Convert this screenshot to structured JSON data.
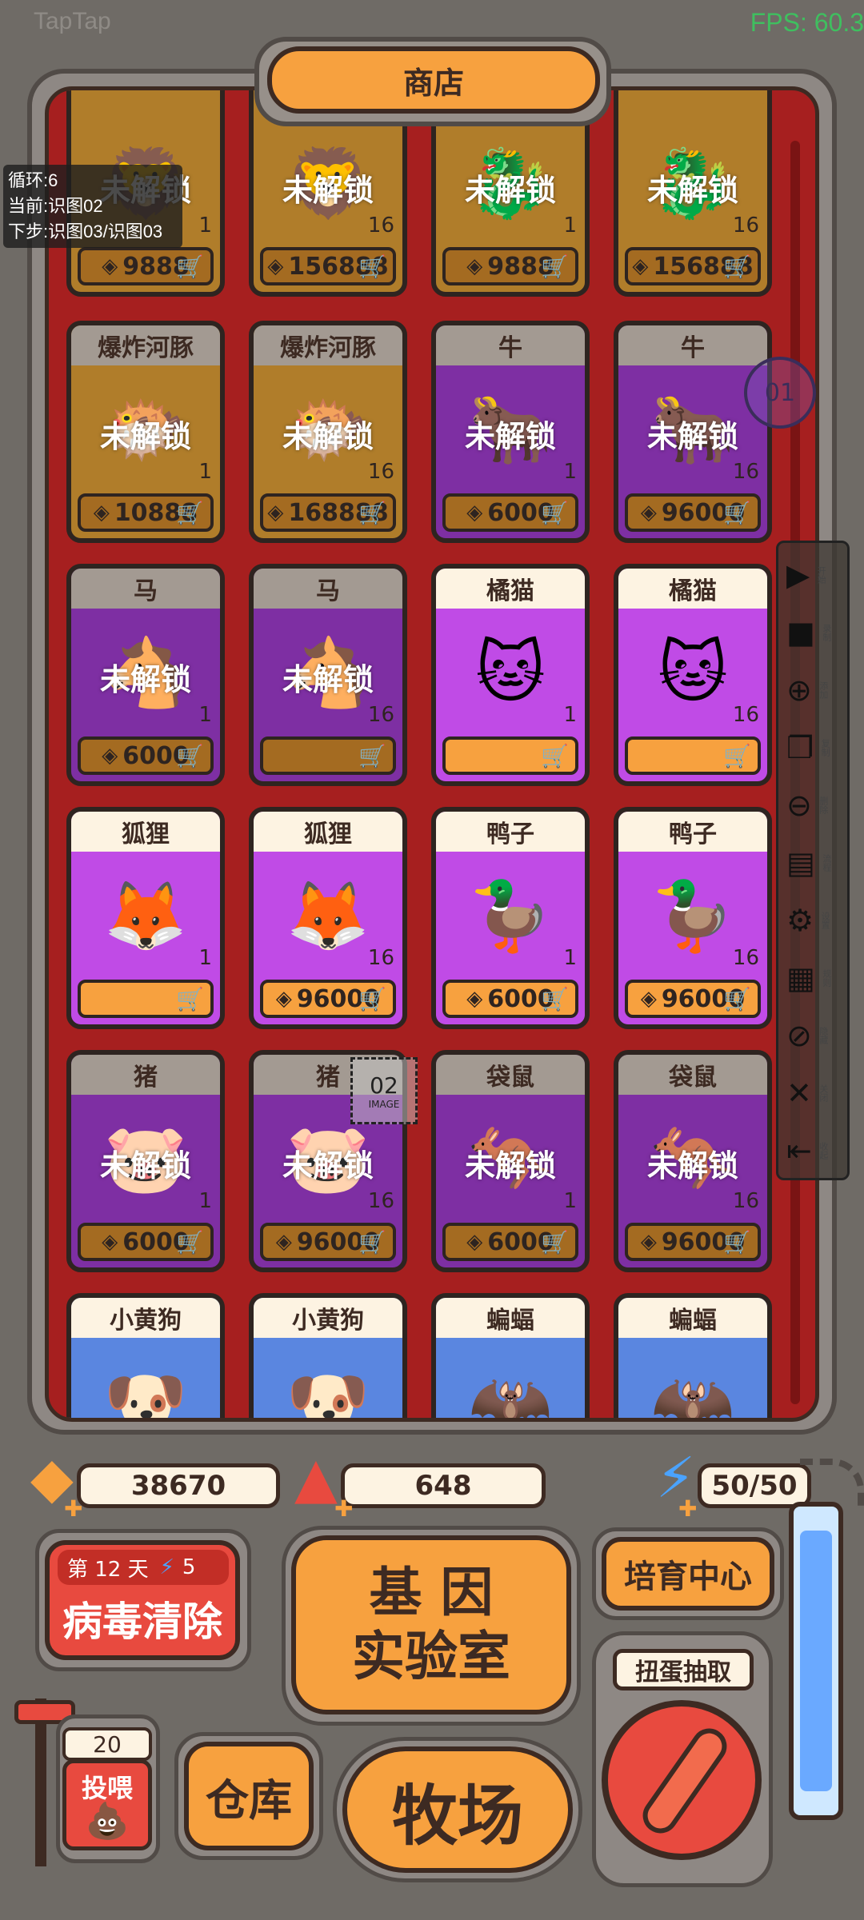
{
  "status": {
    "app": "TapTap",
    "fps": "FPS: 60.3"
  },
  "shop": {
    "title": "商店"
  },
  "debug": {
    "loop": "循环:6",
    "current": "当前:识图02",
    "next": "下步:识图03/识图03"
  },
  "crosshair": {
    "label": "01"
  },
  "image_marker": {
    "label": "02",
    "sub": "IMAGE"
  },
  "toolbar": [
    {
      "icon": "play-icon",
      "glyph": "▶",
      "label": "开始"
    },
    {
      "icon": "record-icon",
      "glyph": "■",
      "label": "录制"
    },
    {
      "icon": "add-icon",
      "glyph": "⊕",
      "label": "添加"
    },
    {
      "icon": "copy-icon",
      "glyph": "❐",
      "label": "复制"
    },
    {
      "icon": "remove-icon",
      "glyph": "⊖",
      "label": "删除"
    },
    {
      "icon": "flow-icon",
      "glyph": "▤",
      "label": "流程"
    },
    {
      "icon": "settings-icon",
      "glyph": "⚙",
      "label": "设置"
    },
    {
      "icon": "rules-icon",
      "glyph": "▦",
      "label": "规则"
    },
    {
      "icon": "hide-icon",
      "glyph": "⊘",
      "label": "隐藏"
    },
    {
      "icon": "close-icon",
      "glyph": "✕",
      "label": "关闭"
    },
    {
      "icon": "collapse-icon",
      "glyph": "⇤",
      "label": "收起"
    }
  ],
  "cards": [
    {
      "name": "",
      "pic": "🦁",
      "locked": "未解锁",
      "count": "1",
      "price": "9888",
      "bg": "#b07d2a",
      "hdr": "#b07d2a",
      "btn": "#a46b21"
    },
    {
      "name": "",
      "pic": "🦁",
      "locked": "未解锁",
      "count": "16",
      "price": "156888",
      "bg": "#b07d2a",
      "hdr": "#b07d2a",
      "btn": "#a46b21"
    },
    {
      "name": "",
      "pic": "🐉",
      "locked": "未解锁",
      "count": "1",
      "price": "9888",
      "bg": "#b07d2a",
      "hdr": "#b07d2a",
      "btn": "#a46b21"
    },
    {
      "name": "",
      "pic": "🐉",
      "locked": "未解锁",
      "count": "16",
      "price": "156888",
      "bg": "#b07d2a",
      "hdr": "#b07d2a",
      "btn": "#a46b21"
    },
    {
      "name": "爆炸河豚",
      "pic": "🐡",
      "locked": "未解锁",
      "count": "1",
      "price": "10888",
      "bg": "#b07d2a",
      "hdr": "#a39a92",
      "btn": "#a46b21"
    },
    {
      "name": "爆炸河豚",
      "pic": "🐡",
      "locked": "未解锁",
      "count": "16",
      "price": "168888",
      "bg": "#b07d2a",
      "hdr": "#a39a92",
      "btn": "#a46b21"
    },
    {
      "name": "牛",
      "pic": "🐂",
      "locked": "未解锁",
      "count": "1",
      "price": "6000",
      "bg": "#7e2fa3",
      "hdr": "#a39a92",
      "btn": "#a46b21"
    },
    {
      "name": "牛",
      "pic": "🐂",
      "locked": "未解锁",
      "count": "16",
      "price": "96000",
      "bg": "#7e2fa3",
      "hdr": "#a39a92",
      "btn": "#a46b21"
    },
    {
      "name": "马",
      "pic": "🐴",
      "locked": "未解锁",
      "count": "1",
      "price": "6000",
      "bg": "#7e2fa3",
      "hdr": "#a39a92",
      "btn": "#a46b21"
    },
    {
      "name": "马",
      "pic": "🐴",
      "locked": "未解锁",
      "count": "16",
      "price": "",
      "bg": "#7e2fa3",
      "hdr": "#a39a92",
      "btn": "#a46b21"
    },
    {
      "name": "橘猫",
      "pic": "🐱",
      "locked": "",
      "count": "1",
      "price": "",
      "bg": "#c04be6",
      "hdr": "#fdf3e2",
      "btn": "#f7a13f"
    },
    {
      "name": "橘猫",
      "pic": "🐱",
      "locked": "",
      "count": "16",
      "price": "",
      "bg": "#c04be6",
      "hdr": "#fdf3e2",
      "btn": "#f7a13f"
    },
    {
      "name": "狐狸",
      "pic": "🦊",
      "locked": "",
      "count": "1",
      "price": "",
      "bg": "#c04be6",
      "hdr": "#fdf3e2",
      "btn": "#f7a13f"
    },
    {
      "name": "狐狸",
      "pic": "🦊",
      "locked": "",
      "count": "16",
      "price": "96000",
      "bg": "#c04be6",
      "hdr": "#fdf3e2",
      "btn": "#f7a13f"
    },
    {
      "name": "鸭子",
      "pic": "🦆",
      "locked": "",
      "count": "1",
      "price": "6000",
      "bg": "#c04be6",
      "hdr": "#fdf3e2",
      "btn": "#f7a13f"
    },
    {
      "name": "鸭子",
      "pic": "🦆",
      "locked": "",
      "count": "16",
      "price": "96000",
      "bg": "#c04be6",
      "hdr": "#fdf3e2",
      "btn": "#f7a13f"
    },
    {
      "name": "猪",
      "pic": "🐷",
      "locked": "未解锁",
      "count": "1",
      "price": "6000",
      "bg": "#7e2fa3",
      "hdr": "#a39a92",
      "btn": "#a46b21"
    },
    {
      "name": "猪",
      "pic": "🐷",
      "locked": "未解锁",
      "count": "16",
      "price": "96000",
      "bg": "#7e2fa3",
      "hdr": "#a39a92",
      "btn": "#a46b21"
    },
    {
      "name": "袋鼠",
      "pic": "🦘",
      "locked": "未解锁",
      "count": "1",
      "price": "6000",
      "bg": "#7e2fa3",
      "hdr": "#a39a92",
      "btn": "#a46b21"
    },
    {
      "name": "袋鼠",
      "pic": "🦘",
      "locked": "未解锁",
      "count": "16",
      "price": "96000",
      "bg": "#7e2fa3",
      "hdr": "#a39a92",
      "btn": "#a46b21"
    },
    {
      "name": "小黄狗",
      "pic": "🐶",
      "locked": "",
      "count": "",
      "price": "",
      "bg": "#5a86e0",
      "hdr": "#fdf3e2",
      "btn": "#f7a13f"
    },
    {
      "name": "小黄狗",
      "pic": "🐶",
      "locked": "",
      "count": "",
      "price": "",
      "bg": "#5a86e0",
      "hdr": "#fdf3e2",
      "btn": "#f7a13f"
    },
    {
      "name": "蝙蝠",
      "pic": "🦇",
      "locked": "",
      "count": "",
      "price": "",
      "bg": "#5a86e0",
      "hdr": "#fdf3e2",
      "btn": "#f7a13f"
    },
    {
      "name": "蝙蝠",
      "pic": "🦇",
      "locked": "",
      "count": "",
      "price": "",
      "bg": "#5a86e0",
      "hdr": "#fdf3e2",
      "btn": "#f7a13f"
    }
  ],
  "resources": {
    "gems": "38670",
    "crystals": "648",
    "energy": "50/50"
  },
  "virus": {
    "day": "第 12 天",
    "energy": "5",
    "label": "病毒清除"
  },
  "buttons": {
    "lab": "基 因\n实验室",
    "breed": "培育中心",
    "gacha": "扭蛋抽取",
    "feed_count": "20",
    "feed": "投喂",
    "storage": "仓库",
    "ranch": "牧场"
  }
}
